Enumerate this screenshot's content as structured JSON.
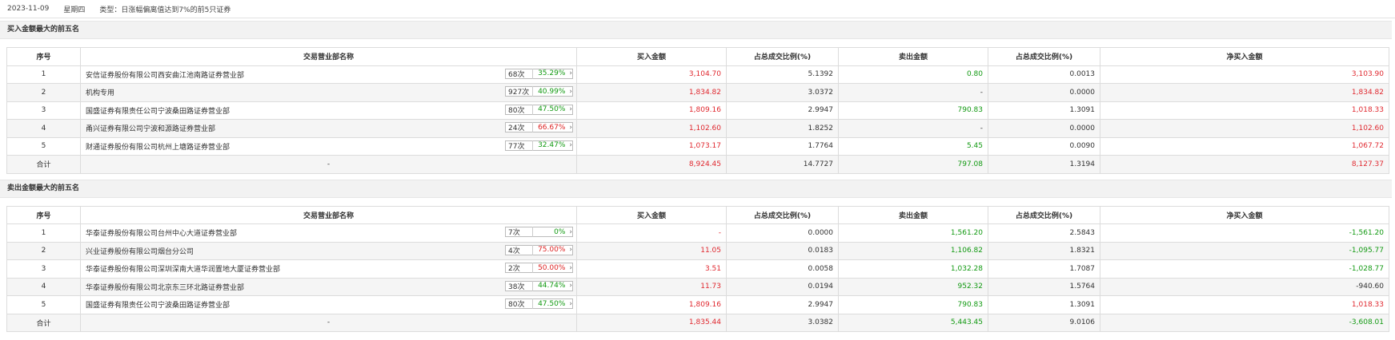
{
  "topbar": {
    "date": "2023-11-09",
    "weekday": "星期四",
    "type": "类型：日涨幅偏离值达到7%的前5只证券"
  },
  "headers": [
    "序号",
    "交易营业部名称",
    "买入金额",
    "占总成交比例(%)",
    "卖出金额",
    "占总成交比例(%)",
    "净买入金额"
  ],
  "buy": {
    "title": "买入金额最大的前五名",
    "rows": [
      {
        "no": "1",
        "name": "安信证券股份有限公司西安曲江池南路证券营业部",
        "count": "68次",
        "pct": "35.29%",
        "buy": "3,104.70",
        "buy_ratio": "5.1392",
        "sell": "0.80",
        "sell_ratio": "0.0013",
        "net": "3,103.90"
      },
      {
        "no": "2",
        "name": "机构专用",
        "count": "927次",
        "pct": "40.99%",
        "buy": "1,834.82",
        "buy_ratio": "3.0372",
        "sell": "-",
        "sell_ratio": "0.0000",
        "net": "1,834.82"
      },
      {
        "no": "3",
        "name": "国盛证券有限责任公司宁波桑田路证券营业部",
        "count": "80次",
        "pct": "47.50%",
        "buy": "1,809.16",
        "buy_ratio": "2.9947",
        "sell": "790.83",
        "sell_ratio": "1.3091",
        "net": "1,018.33"
      },
      {
        "no": "4",
        "name": "甬兴证券有限公司宁波和源路证券营业部",
        "count": "24次",
        "pct": "66.67%",
        "buy": "1,102.60",
        "buy_ratio": "1.8252",
        "sell": "-",
        "sell_ratio": "0.0000",
        "net": "1,102.60"
      },
      {
        "no": "5",
        "name": "财通证券股份有限公司杭州上塘路证券营业部",
        "count": "77次",
        "pct": "32.47%",
        "buy": "1,073.17",
        "buy_ratio": "1.7764",
        "sell": "5.45",
        "sell_ratio": "0.0090",
        "net": "1,067.72"
      }
    ],
    "total": {
      "label": "合计",
      "name": "-",
      "buy": "8,924.45",
      "buy_ratio": "14.7727",
      "sell": "797.08",
      "sell_ratio": "1.3194",
      "net": "8,127.37"
    }
  },
  "sell": {
    "title": "卖出金额最大的前五名",
    "rows": [
      {
        "no": "1",
        "name": "华泰证券股份有限公司台州中心大道证券营业部",
        "count": "7次",
        "pct": "0%",
        "buy": "-",
        "buy_ratio": "0.0000",
        "sell": "1,561.20",
        "sell_ratio": "2.5843",
        "net": "-1,561.20"
      },
      {
        "no": "2",
        "name": "兴业证券股份有限公司烟台分公司",
        "count": "4次",
        "pct": "75.00%",
        "buy": "11.05",
        "buy_ratio": "0.0183",
        "sell": "1,106.82",
        "sell_ratio": "1.8321",
        "net": "-1,095.77"
      },
      {
        "no": "3",
        "name": "华泰证券股份有限公司深圳深南大道华润置地大厦证券营业部",
        "count": "2次",
        "pct": "50.00%",
        "buy": "3.51",
        "buy_ratio": "0.0058",
        "sell": "1,032.28",
        "sell_ratio": "1.7087",
        "net": "-1,028.77"
      },
      {
        "no": "4",
        "name": "华泰证券股份有限公司北京东三环北路证券营业部",
        "count": "38次",
        "pct": "44.74%",
        "buy": "11.73",
        "buy_ratio": "0.0194",
        "sell": "952.32",
        "sell_ratio": "1.5764",
        "net": "-940.60"
      },
      {
        "no": "5",
        "name": "国盛证券有限责任公司宁波桑田路证券营业部",
        "count": "80次",
        "pct": "47.50%",
        "buy": "1,809.16",
        "buy_ratio": "2.9947",
        "sell": "790.83",
        "sell_ratio": "1.3091",
        "net": "1,018.33"
      }
    ],
    "total": {
      "label": "合计",
      "name": "-",
      "buy": "1,835.44",
      "buy_ratio": "3.0382",
      "sell": "5,443.45",
      "sell_ratio": "9.0106",
      "net": "-3,608.01"
    }
  },
  "colors": {
    "up": "#e0282f",
    "down": "#119911"
  }
}
